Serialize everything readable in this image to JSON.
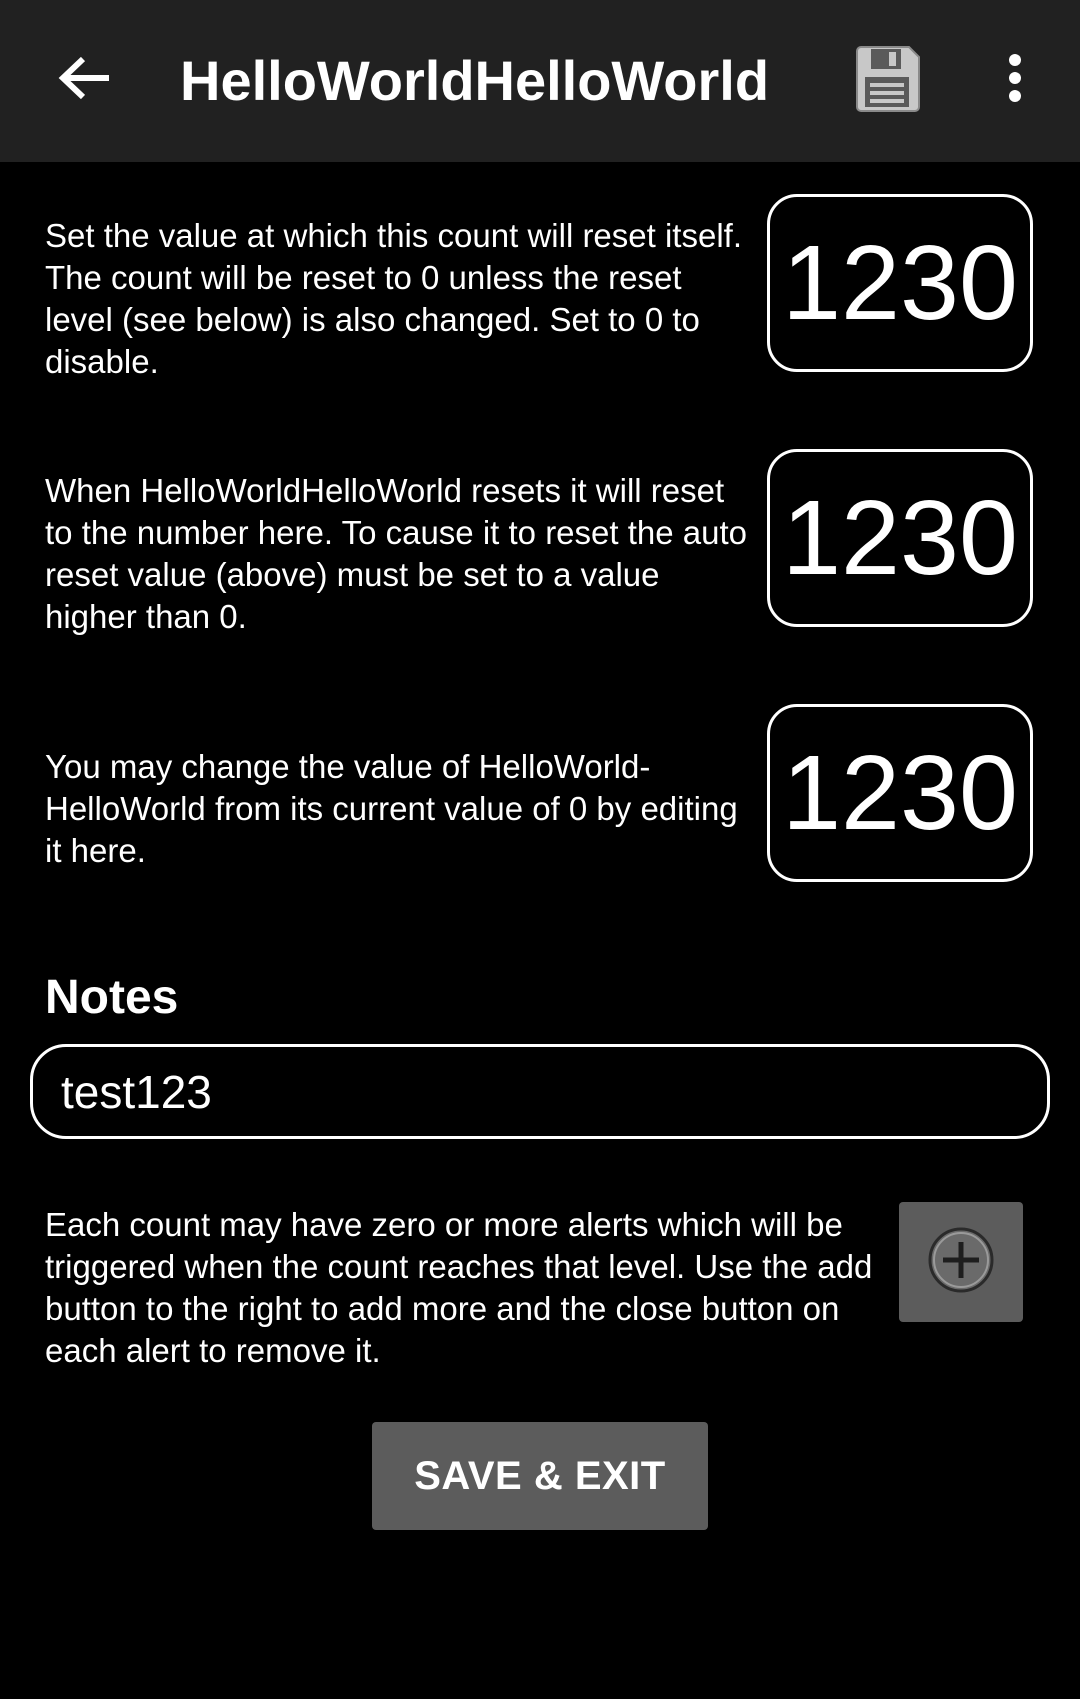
{
  "appbar": {
    "title": "HelloWorldHelloWorld",
    "back_icon": "arrow-left-icon",
    "save_icon": "floppy-disk-icon",
    "overflow_icon": "more-vert-icon",
    "background": "#212121"
  },
  "settings": [
    {
      "id": "auto-reset",
      "description": "Set the value at which this count will reset itself. The count will be reset to 0 unless the reset level (see below) is also changed. Set to 0 to disable.",
      "value": "1230"
    },
    {
      "id": "reset-level",
      "description": "When HelloWorldHelloWorld resets it will reset to the number here. To cause it to reset the auto reset value (above) must be set to a value higher than 0.",
      "value": "1230"
    },
    {
      "id": "current-value",
      "description": "You may change the value of HelloWorld-HelloWorld from its current value of 0 by editing it here.",
      "value": "1230"
    }
  ],
  "notes": {
    "heading": "Notes",
    "value": "test123"
  },
  "alerts": {
    "description": "Each count may have zero or more alerts which will be triggered when the count reaches that level. Use the add button to the right to add more and the close button on each alert to remove it.",
    "add_icon": "add-circle-icon"
  },
  "footer": {
    "save_exit_label": "SAVE & EXIT"
  },
  "colors": {
    "background": "#000000",
    "button": "#5c5c5c",
    "text": "#ffffff"
  }
}
